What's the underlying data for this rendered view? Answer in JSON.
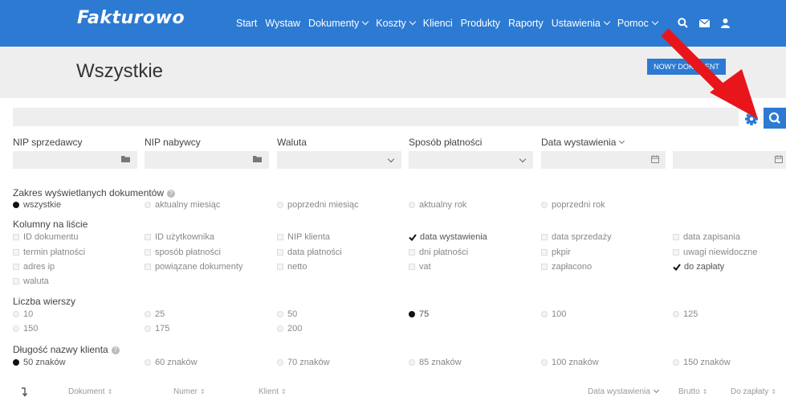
{
  "brand": {
    "logo": "Fakturowo",
    "primary": "#2d7ad2",
    "arrow": "#e8151b"
  },
  "nav": {
    "items": [
      {
        "label": "Start",
        "dropdown": false
      },
      {
        "label": "Wystaw",
        "dropdown": false
      },
      {
        "label": "Dokumenty",
        "dropdown": true
      },
      {
        "label": "Koszty",
        "dropdown": true
      },
      {
        "label": "Klienci",
        "dropdown": false
      },
      {
        "label": "Produkty",
        "dropdown": false
      },
      {
        "label": "Raporty",
        "dropdown": false
      },
      {
        "label": "Ustawienia",
        "dropdown": true
      },
      {
        "label": "Pomoc",
        "dropdown": true
      }
    ],
    "icons": [
      "search-icon",
      "envelope-icon",
      "user-icon"
    ]
  },
  "header": {
    "title": "Wszystkie",
    "new_document": "NOWY DOKUMENT"
  },
  "filters": {
    "nip_sprzedawcy": "NIP sprzedawcy",
    "nip_nabywcy": "NIP nabywcy",
    "waluta": "Waluta",
    "sposob_platnosci": "Sposób płatności",
    "data_wystawienia": "Data wystawienia"
  },
  "zakres": {
    "title": "Zakres wyświetlanych dokumentów",
    "options": [
      "wszystkie",
      "aktualny miesiąc",
      "poprzedni miesiąc",
      "aktualny rok",
      "poprzedni rok"
    ],
    "selected": "wszystkie"
  },
  "kolumny": {
    "title": "Kolumny na liście",
    "items": [
      {
        "label": "ID dokumentu",
        "checked": false
      },
      {
        "label": "ID użytkownika",
        "checked": false
      },
      {
        "label": "NIP klienta",
        "checked": false
      },
      {
        "label": "data wystawienia",
        "checked": true
      },
      {
        "label": "data sprzedaży",
        "checked": false
      },
      {
        "label": "data zapisania",
        "checked": false
      },
      {
        "label": "termin płatności",
        "checked": false
      },
      {
        "label": "sposób płatności",
        "checked": false
      },
      {
        "label": "data płatności",
        "checked": false
      },
      {
        "label": "dni płatności",
        "checked": false
      },
      {
        "label": "pkpir",
        "checked": false
      },
      {
        "label": "uwagi niewidoczne",
        "checked": false
      },
      {
        "label": "adres ip",
        "checked": false
      },
      {
        "label": "powiązane dokumenty",
        "checked": false
      },
      {
        "label": "netto",
        "checked": false
      },
      {
        "label": "vat",
        "checked": false
      },
      {
        "label": "zapłacono",
        "checked": false
      },
      {
        "label": "do zapłaty",
        "checked": true
      },
      {
        "label": "waluta",
        "checked": false
      }
    ]
  },
  "wiersze": {
    "title": "Liczba wierszy",
    "options": [
      "10",
      "25",
      "50",
      "75",
      "100",
      "125",
      "150",
      "175",
      "200"
    ],
    "selected": "75"
  },
  "dlugosc": {
    "title": "Długość nazwy klienta",
    "options": [
      "50 znaków",
      "60 znaków",
      "70 znaków",
      "85 znaków",
      "100 znaków",
      "150 znaków"
    ],
    "selected": "50 znaków"
  },
  "table": {
    "columns": [
      "Dokument",
      "Numer",
      "Klient",
      "Data wystawienia",
      "Brutto",
      "Do zapłaty"
    ]
  }
}
